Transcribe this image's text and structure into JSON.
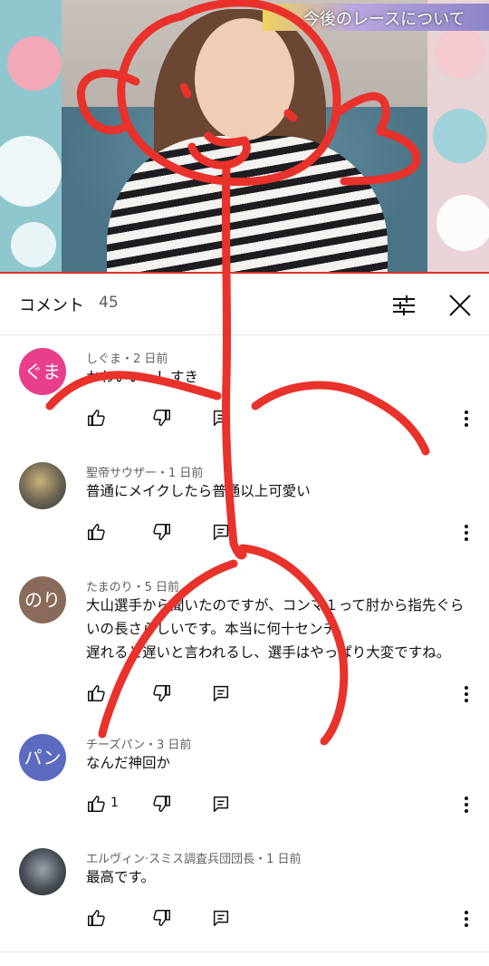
{
  "video": {
    "caption": "今後のレースについて"
  },
  "header": {
    "title": "コメント",
    "count": "45"
  },
  "comments": [
    {
      "author": "しぐま・2 日前",
      "avatar_text": "ぐま",
      "avatar_color": "#e83e8c",
      "lines": [
        "かわいい〜！すき"
      ],
      "likes": ""
    },
    {
      "author": "聖帝サウザー・1 日前",
      "avatar_text": "",
      "avatar_color": "#6b6350",
      "lines": [
        "普通にメイクしたら普通以上可愛い"
      ],
      "likes": ""
    },
    {
      "author": "たまのり・5 日前",
      "avatar_text": "のり",
      "avatar_color": "#8a6a5a",
      "lines": [
        "大山選手から聞いたのですが、コンマ１って肘から指先ぐら",
        "いの長さらしいです。本当に何十センチ。",
        "遅れると遅いと言われるし、選手はやっぱり大変ですね。"
      ],
      "likes": ""
    },
    {
      "author": "チーズパン・3 日前",
      "avatar_text": "パン",
      "avatar_color": "#5c6bc0",
      "lines": [
        "なんだ神回か"
      ],
      "likes": "1"
    },
    {
      "author": "エルヴィン·スミス調査兵団団長・1 日前",
      "avatar_text": "",
      "avatar_color": "#3a3d44",
      "lines": [
        "最高です。"
      ],
      "likes": ""
    }
  ],
  "icons": {
    "like": "thumb-up-icon",
    "dislike": "thumb-down-icon",
    "reply": "reply-icon",
    "more": "more-vert-icon",
    "filter": "sort-filter-icon",
    "close": "close-icon"
  },
  "colors": {
    "drawing": "#e8322b",
    "text": "#0f0f0f",
    "meta": "#606060"
  }
}
